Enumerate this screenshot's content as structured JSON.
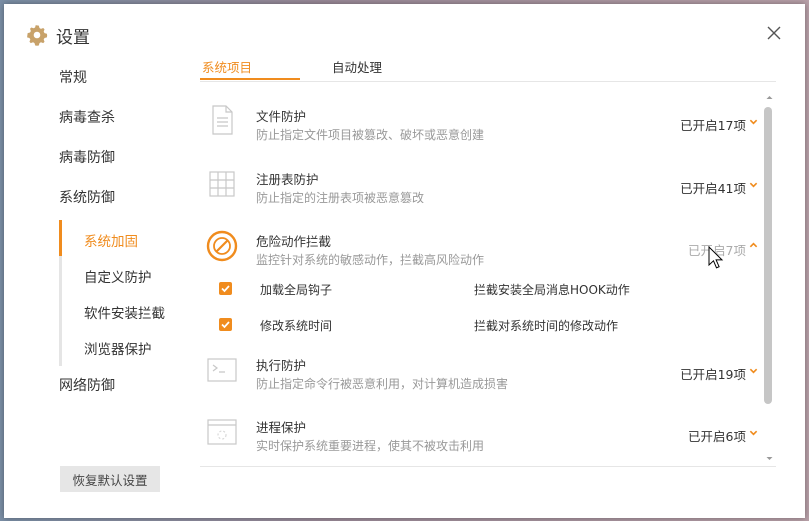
{
  "window": {
    "title": "设置",
    "icons": {
      "title": "gear-icon",
      "close": "close-icon"
    }
  },
  "nav": {
    "items": [
      "常规",
      "病毒查杀",
      "病毒防御",
      "系统防御"
    ],
    "sub_items": [
      {
        "label": "系统加固",
        "active": true
      },
      {
        "label": "自定义防护",
        "active": false
      },
      {
        "label": "软件安装拦截",
        "active": false
      },
      {
        "label": "浏览器保护",
        "active": false
      }
    ],
    "after_items": [
      "网络防御"
    ],
    "restore_label": "恢复默认设置"
  },
  "tabs": [
    {
      "label": "系统项目",
      "active": true
    },
    {
      "label": "自动处理",
      "active": false
    }
  ],
  "rows": [
    {
      "icon": "document-icon",
      "title": "文件防护",
      "desc": "防止指定文件项目被篡改、破坏或恶意创建",
      "status": "已开启17项",
      "expanded": false
    },
    {
      "icon": "registry-grid-icon",
      "title": "注册表防护",
      "desc": "防止指定的注册表项被恶意篡改",
      "status": "已开启41项",
      "expanded": false
    },
    {
      "icon": "forbidden-circle-icon",
      "title": "危险动作拦截",
      "desc": "监控针对系统的敏感动作，拦截高风险动作",
      "status": "已开启7项",
      "expanded": true
    },
    {
      "icon": "terminal-icon",
      "title": "执行防护",
      "desc": "防止指定命令行被恶意利用，对计算机造成损害",
      "status": "已开启19项",
      "expanded": false
    },
    {
      "icon": "process-window-icon",
      "title": "进程保护",
      "desc": "实时保护系统重要进程，使其不被攻击利用",
      "status": "已开启6项",
      "expanded": false
    }
  ],
  "sub_checks": [
    {
      "label": "加载全局钩子",
      "desc": "拦截安装全局消息HOOK动作",
      "checked": true
    },
    {
      "label": "修改系统时间",
      "desc": "拦截对系统时间的修改动作",
      "checked": true
    }
  ],
  "colors": {
    "accent": "#f08c1e",
    "text": "#333333",
    "muted": "#999999",
    "divider": "#e6e6e6"
  }
}
